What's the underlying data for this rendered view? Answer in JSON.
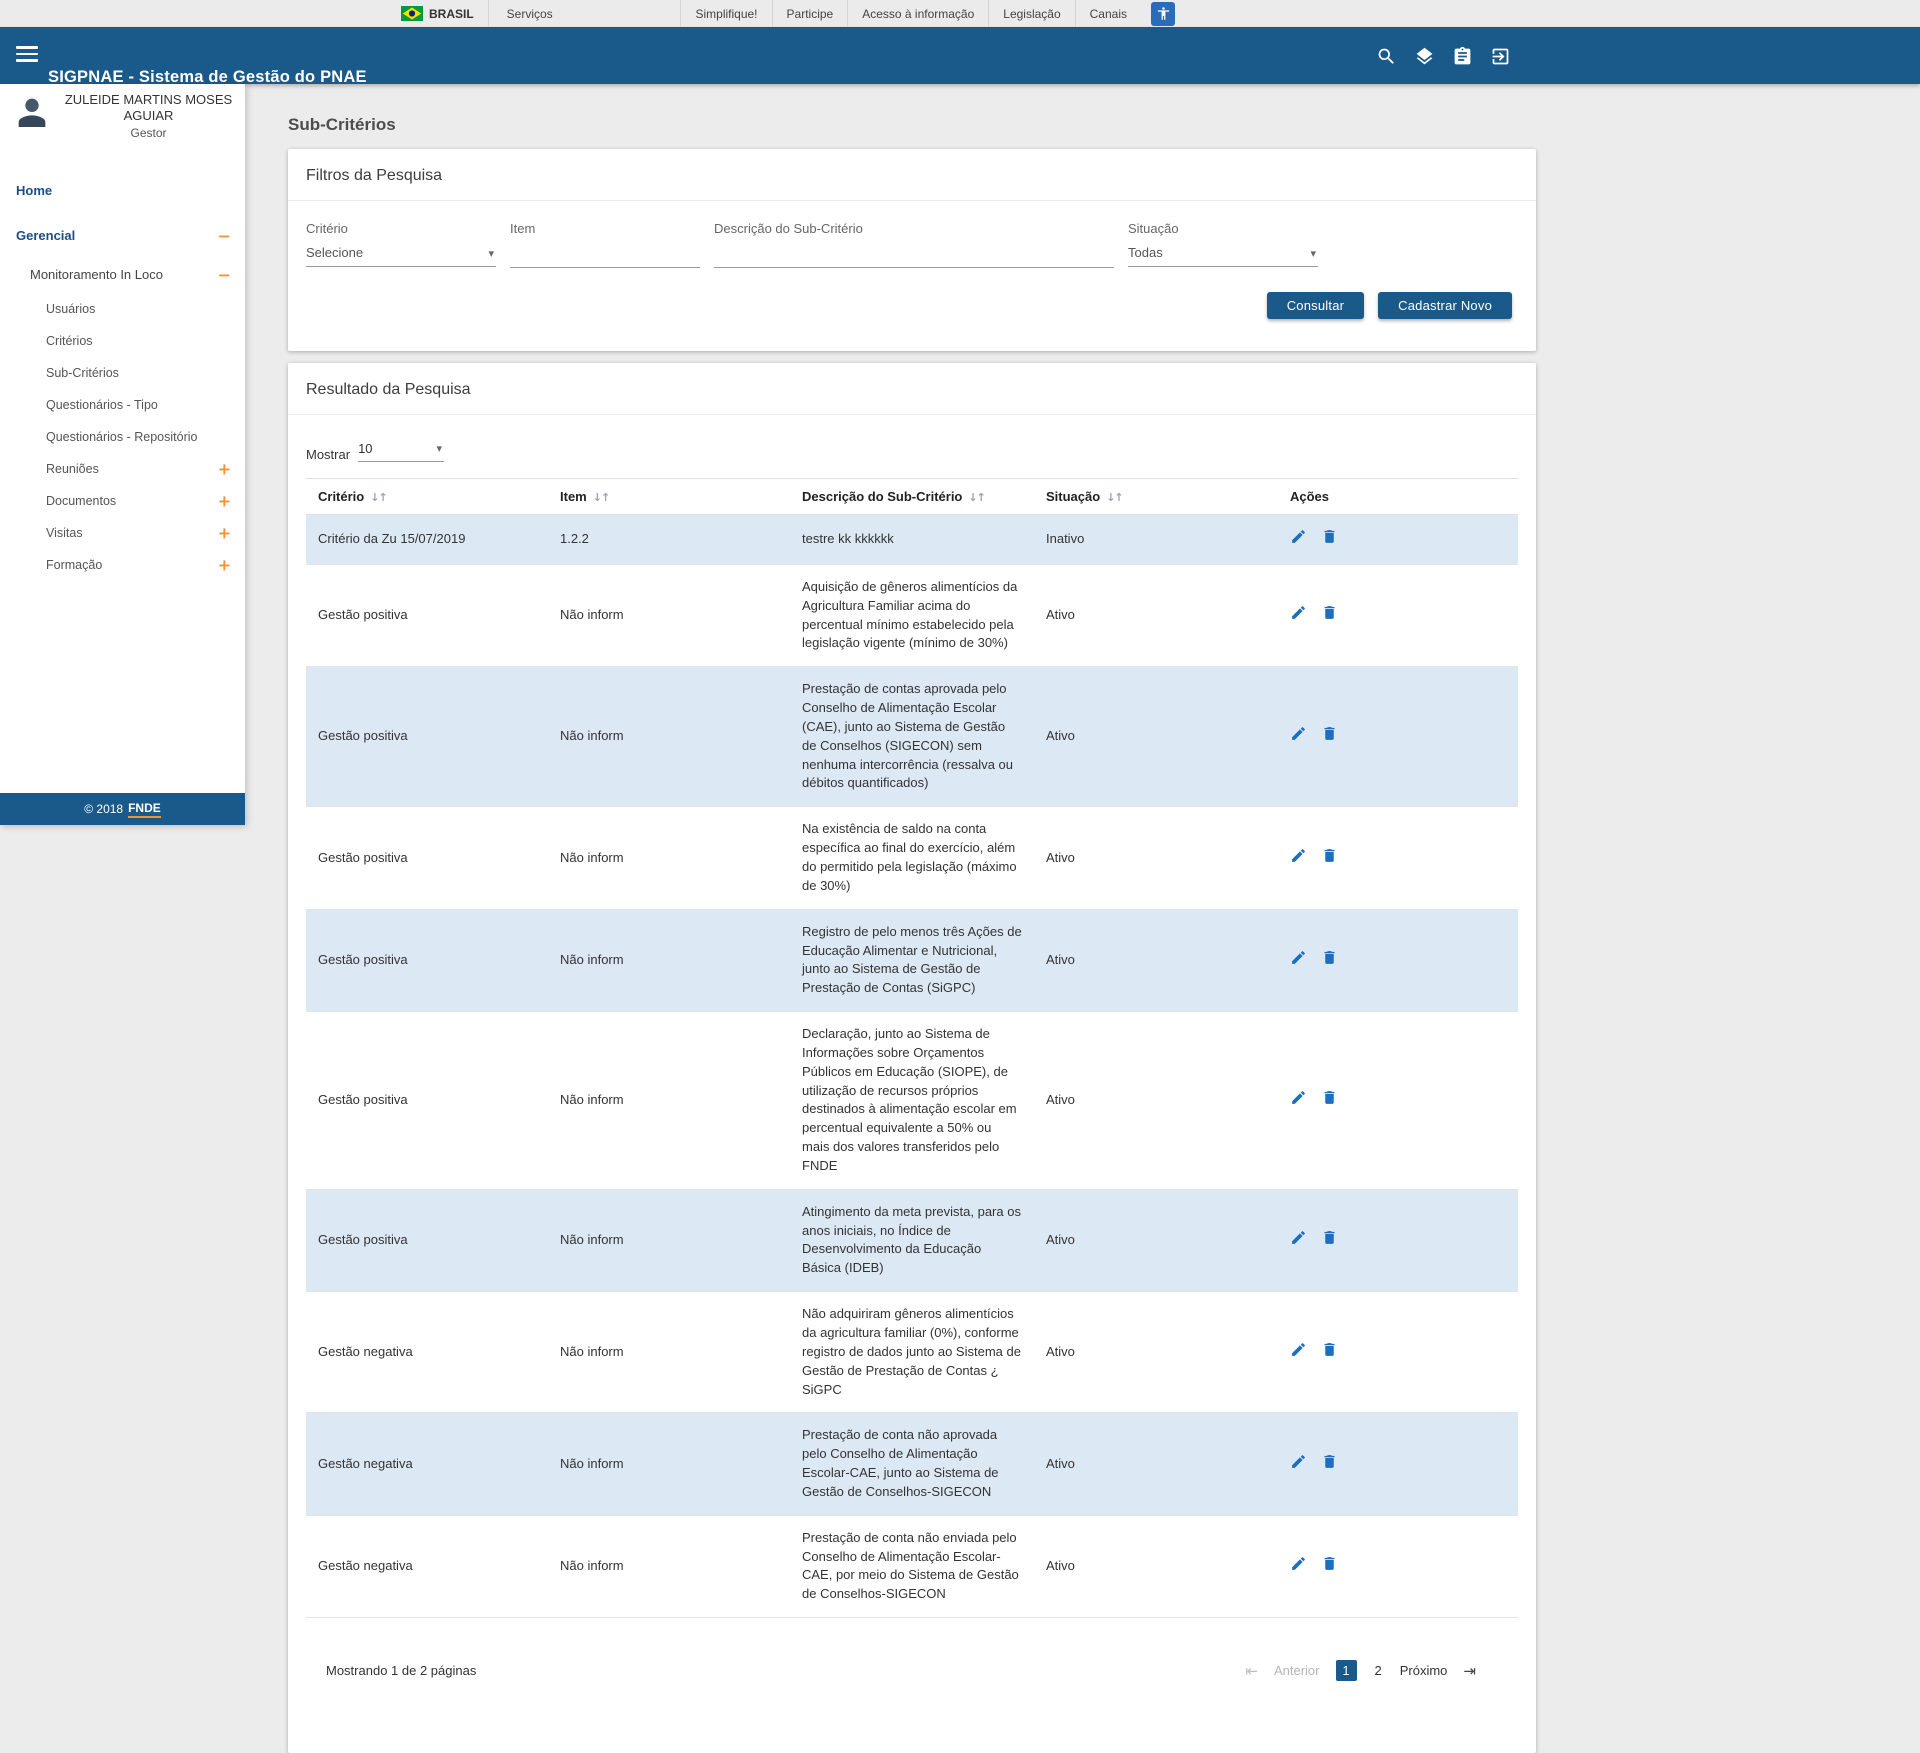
{
  "govbar": {
    "brand": "BRASIL",
    "servicos": "Serviços",
    "links": [
      "Simplifique!",
      "Participe",
      "Acesso à informação",
      "Legislação",
      "Canais"
    ]
  },
  "appbar": {
    "title": "SIGPNAE - Sistema de Gestão do PNAE"
  },
  "user": {
    "name": "ZULEIDE MARTINS MOSES AGUIAR",
    "role": "Gestor"
  },
  "sidebar": {
    "home": "Home",
    "gerencial": "Gerencial",
    "monitoramento": "Monitoramento In Loco",
    "subitems": [
      {
        "label": "Usuários",
        "toggle": ""
      },
      {
        "label": "Critérios",
        "toggle": ""
      },
      {
        "label": "Sub-Critérios",
        "toggle": ""
      },
      {
        "label": "Questionários - Tipo",
        "toggle": ""
      },
      {
        "label": "Questionários - Repositório",
        "toggle": ""
      },
      {
        "label": "Reuniões",
        "toggle": "+"
      },
      {
        "label": "Documentos",
        "toggle": "+"
      },
      {
        "label": "Visitas",
        "toggle": "+"
      },
      {
        "label": "Formação",
        "toggle": "+"
      }
    ],
    "footer": {
      "copyright": "© 2018",
      "brand": "FNDE"
    }
  },
  "page": {
    "title": "Sub-Critérios"
  },
  "filters": {
    "title": "Filtros da Pesquisa",
    "criterio": {
      "label": "Critério",
      "value": "Selecione"
    },
    "item": {
      "label": "Item",
      "value": ""
    },
    "descricao": {
      "label": "Descrição do Sub-Critério",
      "value": ""
    },
    "situacao": {
      "label": "Situação",
      "value": "Todas"
    },
    "buttons": {
      "consultar": "Consultar",
      "cadastrar": "Cadastrar Novo"
    }
  },
  "results": {
    "title": "Resultado da Pesquisa",
    "mostrar": {
      "label": "Mostrar",
      "value": "10"
    },
    "columns": [
      "Critério",
      "Item",
      "Descrição do Sub-Critério",
      "Situação",
      "Ações"
    ],
    "rows": [
      {
        "criterio": "Critério da Zu 15/07/2019",
        "item": "1.2.2",
        "descricao": "testre kk kkkkkk",
        "situacao": "Inativo"
      },
      {
        "criterio": "Gestão positiva",
        "item": "Não inform",
        "descricao": "Aquisição de gêneros alimentícios da Agricultura Familiar acima do percentual mínimo estabelecido pela legislação vigente (mínimo de 30%)",
        "situacao": "Ativo"
      },
      {
        "criterio": "Gestão positiva",
        "item": "Não inform",
        "descricao": "Prestação de contas aprovada pelo Conselho de Alimentação Escolar (CAE), junto ao Sistema de Gestão de Conselhos (SIGECON) sem nenhuma intercorrência (ressalva ou débitos quantificados)",
        "situacao": "Ativo"
      },
      {
        "criterio": "Gestão positiva",
        "item": "Não inform",
        "descricao": "Na existência de saldo na conta específica ao final do exercício, além do permitido pela legislação (máximo de 30%)",
        "situacao": "Ativo"
      },
      {
        "criterio": "Gestão positiva",
        "item": "Não inform",
        "descricao": "Registro de pelo menos três Ações de Educação Alimentar e Nutricional, junto ao Sistema de Gestão de Prestação de Contas (SiGPC)",
        "situacao": "Ativo"
      },
      {
        "criterio": "Gestão positiva",
        "item": "Não inform",
        "descricao": "Declaração, junto ao Sistema de Informações sobre Orçamentos Públicos em Educação (SIOPE), de utilização de recursos próprios destinados à alimentação escolar em percentual equivalente a 50% ou mais dos valores transferidos pelo FNDE",
        "situacao": "Ativo"
      },
      {
        "criterio": "Gestão positiva",
        "item": "Não inform",
        "descricao": "Atingimento da meta prevista, para os anos iniciais, no Índice de Desenvolvimento da Educação Básica (IDEB)",
        "situacao": "Ativo"
      },
      {
        "criterio": "Gestão negativa",
        "item": "Não inform",
        "descricao": "Não adquiriram gêneros alimentícios da agricultura familiar (0%), conforme registro de dados junto ao Sistema de Gestão de Prestação de Contas ¿ SiGPC",
        "situacao": "Ativo"
      },
      {
        "criterio": "Gestão negativa",
        "item": "Não inform",
        "descricao": "Prestação de conta não aprovada pelo Conselho de Alimentação Escolar-CAE, junto ao Sistema de Gestão de Conselhos-SIGECON",
        "situacao": "Ativo"
      },
      {
        "criterio": "Gestão negativa",
        "item": "Não inform",
        "descricao": "Prestação de conta não enviada pelo Conselho de Alimentação Escolar-CAE, por meio do Sistema de Gestão de Conselhos-SIGECON",
        "situacao": "Ativo"
      }
    ],
    "summary": "Mostrando 1 de 2 páginas",
    "pagination": {
      "anterior": "Anterior",
      "pages": [
        "1",
        "2"
      ],
      "active_page": "1",
      "proximo": "Próximo"
    }
  },
  "icons": {
    "first_page": "⇤",
    "last_page": "⇥",
    "sort": "↓↑",
    "chevron": "▾",
    "toggle_expanded": "−",
    "toggle_collapsed": "+"
  },
  "colors": {
    "primary_blue": "#1a5a8a",
    "accent_orange": "#f09433",
    "row_stripe": "#dce9f5",
    "action_icon_blue": "#1d6fbe"
  }
}
